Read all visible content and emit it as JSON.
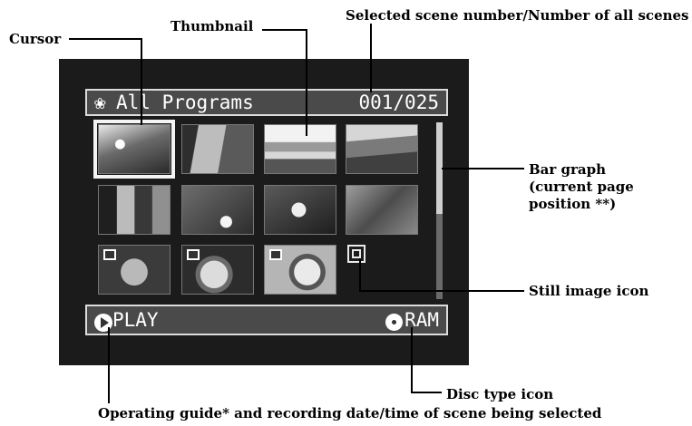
{
  "annotations": {
    "cursor": "Cursor",
    "thumbnail": "Thumbnail",
    "selected_scene": "Selected scene number/Number of all scenes",
    "bar_graph_1": "Bar graph",
    "bar_graph_2": "(current page",
    "bar_graph_3": "position **)",
    "still_image_icon": "Still image icon",
    "disc_type_icon": "Disc type icon",
    "operating_guide": "Operating guide* and recording date/time of scene being selected"
  },
  "screen": {
    "title_icon": "disc-menu-icon",
    "title": "All Programs",
    "counter": "001/025",
    "bottom_left_icon": "play-icon",
    "bottom_left": "PLAY",
    "bottom_right_icon": "disc-icon",
    "bottom_right": "RAM",
    "selected_index": 1,
    "total_scenes": 25,
    "scrollbar": {
      "position_fraction": 0.0,
      "visible_fraction": 0.48
    }
  }
}
